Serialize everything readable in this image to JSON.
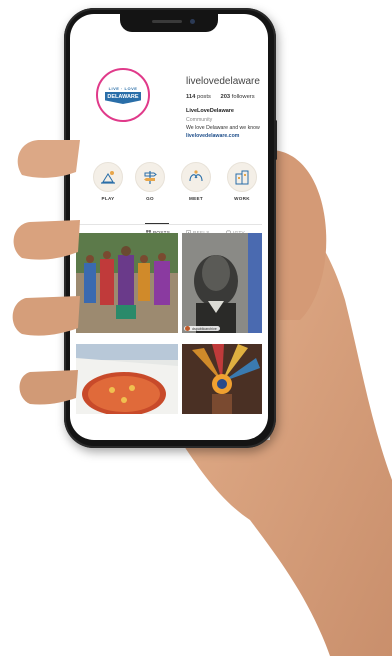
{
  "profile": {
    "username": "livelovedelaware",
    "logo_top": "LIVE · LOVE",
    "logo_text": "DELAWARE",
    "posts_count": "114",
    "posts_label": "posts",
    "followers_count": "203",
    "followers_label": "followers",
    "display_name": "LiveLoveDelaware",
    "category": "Community",
    "bio": "We love Delaware and we know",
    "link": "livelovedelaware.com"
  },
  "highlights": [
    {
      "label": "PLAY",
      "icon": "play-icon"
    },
    {
      "label": "GO",
      "icon": "signpost-icon"
    },
    {
      "label": "MEET",
      "icon": "hands-icon"
    },
    {
      "label": "WORK",
      "icon": "building-icon"
    }
  ],
  "tabs": [
    {
      "label": "POSTS",
      "active": true
    },
    {
      "label": "REELS",
      "active": false
    },
    {
      "label": "IGTV",
      "active": false
    }
  ],
  "posts": [
    {
      "name": "dancers-photo"
    },
    {
      "name": "portrait-photo",
      "tag": "dspublicarchive"
    },
    {
      "name": "pizza-photo"
    },
    {
      "name": "headdress-photo"
    }
  ],
  "colors": {
    "ring": "#e03a8a",
    "brand_blue": "#2a6ea8",
    "link": "#1f4f8b",
    "phone_body": "#141414",
    "skin": "#d9a27e"
  }
}
